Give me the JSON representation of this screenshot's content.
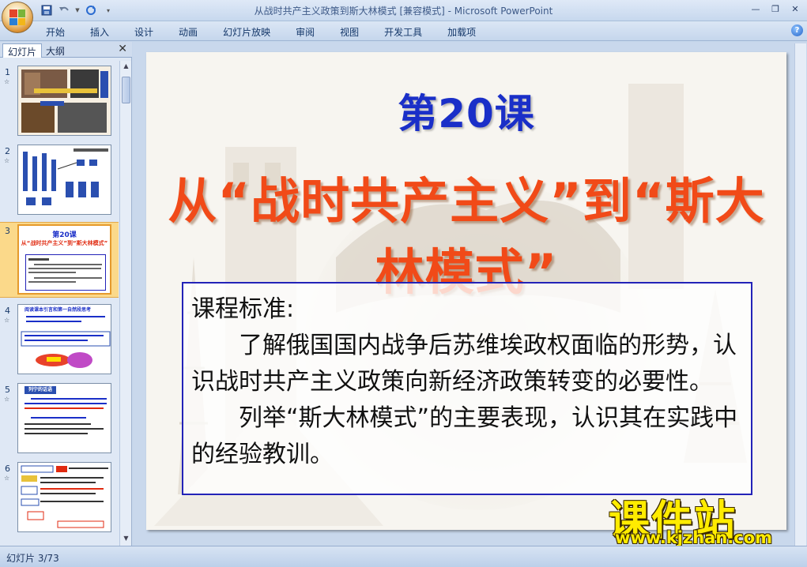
{
  "window": {
    "title": "从战时共产主义政策到斯大林模式 [兼容模式] - Microsoft PowerPoint"
  },
  "ribbon": {
    "tabs": [
      "开始",
      "插入",
      "设计",
      "动画",
      "幻灯片放映",
      "审阅",
      "视图",
      "开发工具",
      "加载项"
    ]
  },
  "left_panel": {
    "tabs": [
      "幻灯片",
      "大纲"
    ],
    "slide_numbers": [
      "1",
      "2",
      "3",
      "4",
      "5",
      "6"
    ],
    "thumbnail_texts": {
      "slide3_lesson": "第20课",
      "slide3_title": "从“战时共产主义”到“斯大林模式”",
      "slide4_question": "阅读课本引言和第一自然段思考",
      "slide5_heading": "列宁的话语"
    }
  },
  "slide": {
    "lesson_number": "第20课",
    "lesson_title": "从“战时共产主义”到“斯大林模式”",
    "standard_heading": "课程标准:",
    "standard_para1": "了解俄国国内战争后苏维埃政权面临的形势，认识战时共产主义政策向新经济政策转变的必要性。",
    "standard_para2": "列举“斯大林模式”的主要表现，认识其在实践中的经验教训。"
  },
  "watermark": {
    "main": "课件站",
    "url": "www.kjzhan.com"
  },
  "statusbar": {
    "slide_indicator": "幻灯片 3/73"
  },
  "colors": {
    "lesson_number": "#1a2fc8",
    "lesson_title": "#f14a18",
    "standard_border": "#2323b8",
    "selected_thumb": "#fbd98a",
    "watermark": "#ffec00"
  }
}
